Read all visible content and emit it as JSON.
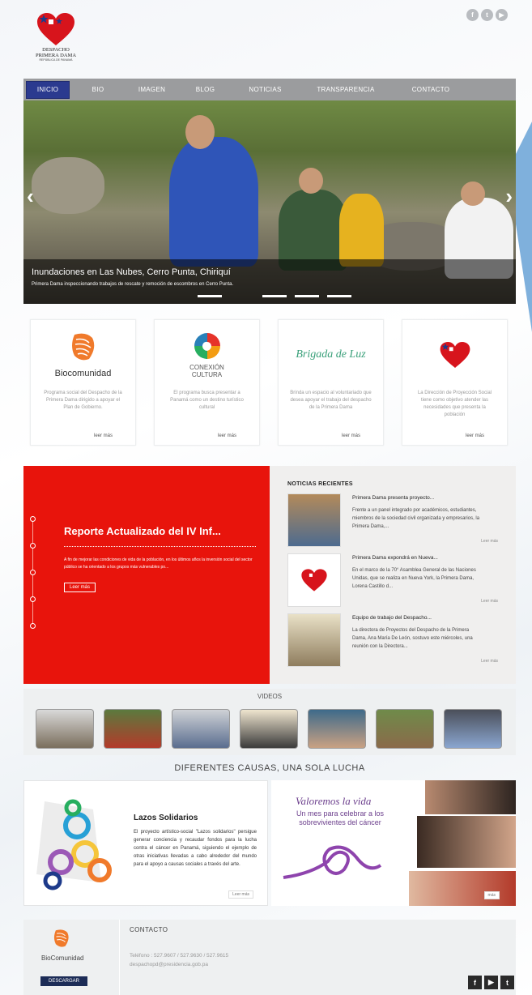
{
  "header": {
    "logo_line1": "DESPACHO",
    "logo_line2": "PRIMERA DAMA",
    "logo_line3": "REPÚBLICA DE PANAMÁ",
    "social_icons": [
      "facebook-icon",
      "twitter-icon",
      "youtube-icon"
    ]
  },
  "nav": {
    "items": [
      "INICIO",
      "BIO",
      "IMAGEN",
      "BLOG",
      "NOTICIAS",
      "TRANSPARENCIA",
      "CONTACTO"
    ],
    "active": "INICIO"
  },
  "slider": {
    "title": "Inundaciones en Las Nubes, Cerro Punta, Chiriquí",
    "subtitle": "Primera Dama inspeccionando trabajos de rescate y remoción de escombros en Cerro Punta."
  },
  "programs": [
    {
      "name": "Biocomunidad",
      "desc": "Programa social del Despacho de la Primera Dama dirigido a apoyar el Plan de Gobierno.",
      "more": "leer más"
    },
    {
      "name": "CONEXIÓN CULTURA",
      "desc": "El programa busca presentar a Panamá como un destino turístico cultural",
      "more": "leer más"
    },
    {
      "name": "Brigada de Luz",
      "desc": "Brinda un espacio al voluntariado que desea apoyar el trabajo del despacho de la Primera Dama",
      "more": "leer más"
    },
    {
      "name": "",
      "desc": "La Dirección de Proyección Social tiene como objetivo atender las necesidades que presenta la población",
      "more": "leer más"
    }
  ],
  "informe": {
    "title": "Reporte Actualizado del IV Inf...",
    "text": "A fin de mejorar las condiciones de vida de la población, en los últimos años la inversión social del sector público se ha orientado a los grupos más vulnerables po...",
    "button": "Leer más"
  },
  "news": {
    "heading": "NOTICIAS RECIENTES",
    "items": [
      {
        "title": "Primera Dama presenta proyecto...",
        "desc": "Frente a un panel integrado por académicos, estudiantes, miembros de la sociedad civil organizada y empresarios, la Primera Dama,...",
        "more": "Leer más"
      },
      {
        "title": "Primera Dama expondrá en Nueva...",
        "desc": "En el marco de la 70° Asamblea General de las Naciones Unidas, que se realiza en Nueva York, la Primera Dama, Lorena Castillo d...",
        "more": "Leer más"
      },
      {
        "title": "Equipo de trabajo del Despacho...",
        "desc": "La directora de Proyectos del Despacho de la Primera Dama, Ana María De León, sostuvo este miércoles, una reunión con la Directora...",
        "more": "Leer más"
      }
    ]
  },
  "videos": {
    "heading": "VIDEOS"
  },
  "causas": {
    "heading": "DIFERENTES CAUSAS, UNA SOLA LUCHA",
    "lazos_title": "Lazos Solidarios",
    "lazos_text": "El proyecto artístico-social \"Lazos solidarios\" persigue generar conciencia y recaudar fondos para la lucha contra el cáncer en Panamá, siguiendo el ejemplo de otras iniciativas llevadas a cabo alrededor del mundo para el apoyo a causas sociales a través del arte.",
    "lazos_more": "Leer más",
    "valor_title": "Valoremos la vida",
    "valor_text": "Un mes para celebrar a los sobrevivientes del cáncer",
    "valor_more": "más"
  },
  "footer": {
    "brand": "BioComunidad",
    "download": "DESCARGAR",
    "contact_heading": "CONTACTO",
    "phone": "Teléfono : 527.9607 / 527.9630 / 527.9615",
    "email": "despachopd@presidencia.gob.pa",
    "social_icons": [
      "facebook-icon",
      "youtube-icon",
      "twitter-icon"
    ]
  },
  "colors": {
    "nav_active": "#2b3a8f",
    "red": "#e8140c",
    "download": "#1c2c57"
  }
}
